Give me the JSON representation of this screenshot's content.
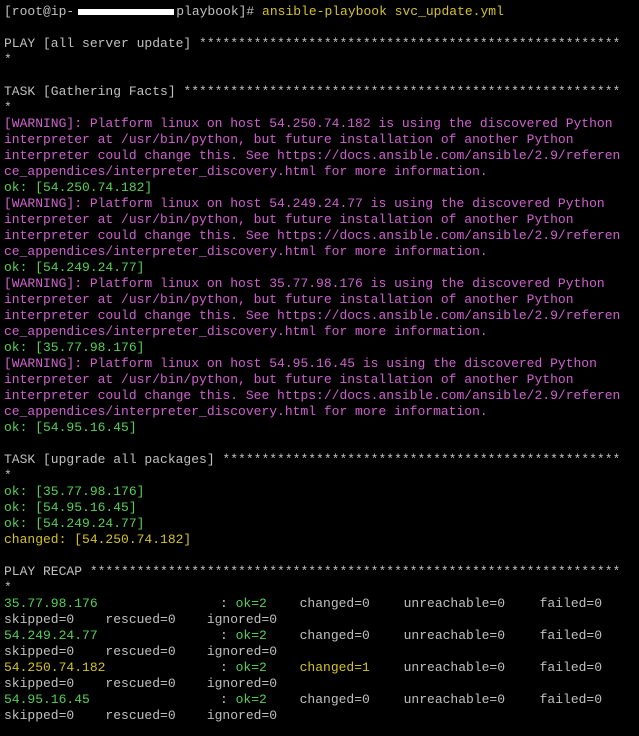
{
  "terminal": {
    "prompt": {
      "user_prefix": "[root@ip-",
      "suffix": "playbook]# ",
      "command": "ansible-playbook svc_update.yml"
    },
    "lines": [
      {
        "t": "blank"
      },
      {
        "t": "text",
        "c": "w",
        "text": "PLAY [all server update] ******************************************************"
      },
      {
        "t": "text",
        "c": "w",
        "text": "*"
      },
      {
        "t": "blank"
      },
      {
        "t": "text",
        "c": "w",
        "text": "TASK [Gathering Facts] ********************************************************"
      },
      {
        "t": "text",
        "c": "w",
        "text": "*"
      },
      {
        "t": "text",
        "c": "m",
        "text": "[WARNING]: Platform linux on host 54.250.74.182 is using the discovered Python"
      },
      {
        "t": "text",
        "c": "m",
        "text": "interpreter at /usr/bin/python, but future installation of another Python"
      },
      {
        "t": "text",
        "c": "m",
        "text": "interpreter could change this. See https://docs.ansible.com/ansible/2.9/referen"
      },
      {
        "t": "text",
        "c": "m",
        "text": "ce_appendices/interpreter_discovery.html for more information."
      },
      {
        "t": "text",
        "c": "g",
        "text": "ok: [54.250.74.182]"
      },
      {
        "t": "text",
        "c": "m",
        "text": "[WARNING]: Platform linux on host 54.249.24.77 is using the discovered Python"
      },
      {
        "t": "text",
        "c": "m",
        "text": "interpreter at /usr/bin/python, but future installation of another Python"
      },
      {
        "t": "text",
        "c": "m",
        "text": "interpreter could change this. See https://docs.ansible.com/ansible/2.9/referen"
      },
      {
        "t": "text",
        "c": "m",
        "text": "ce_appendices/interpreter_discovery.html for more information."
      },
      {
        "t": "text",
        "c": "g",
        "text": "ok: [54.249.24.77]"
      },
      {
        "t": "text",
        "c": "m",
        "text": "[WARNING]: Platform linux on host 35.77.98.176 is using the discovered Python"
      },
      {
        "t": "text",
        "c": "m",
        "text": "interpreter at /usr/bin/python, but future installation of another Python"
      },
      {
        "t": "text",
        "c": "m",
        "text": "interpreter could change this. See https://docs.ansible.com/ansible/2.9/referen"
      },
      {
        "t": "text",
        "c": "m",
        "text": "ce_appendices/interpreter_discovery.html for more information."
      },
      {
        "t": "text",
        "c": "g",
        "text": "ok: [35.77.98.176]"
      },
      {
        "t": "text",
        "c": "m",
        "text": "[WARNING]: Platform linux on host 54.95.16.45 is using the discovered Python"
      },
      {
        "t": "text",
        "c": "m",
        "text": "interpreter at /usr/bin/python, but future installation of another Python"
      },
      {
        "t": "text",
        "c": "m",
        "text": "interpreter could change this. See https://docs.ansible.com/ansible/2.9/referen"
      },
      {
        "t": "text",
        "c": "m",
        "text": "ce_appendices/interpreter_discovery.html for more information."
      },
      {
        "t": "text",
        "c": "g",
        "text": "ok: [54.95.16.45]"
      },
      {
        "t": "blank"
      },
      {
        "t": "text",
        "c": "w",
        "text": "TASK [upgrade all packages] ***************************************************"
      },
      {
        "t": "text",
        "c": "w",
        "text": "*"
      },
      {
        "t": "text",
        "c": "g",
        "text": "ok: [35.77.98.176]"
      },
      {
        "t": "text",
        "c": "g",
        "text": "ok: [54.95.16.45]"
      },
      {
        "t": "text",
        "c": "g",
        "text": "ok: [54.249.24.77]"
      },
      {
        "t": "text",
        "c": "y",
        "text": "changed: [54.250.74.182]"
      },
      {
        "t": "blank"
      },
      {
        "t": "text",
        "c": "w",
        "text": "PLAY RECAP ********************************************************************"
      },
      {
        "t": "text",
        "c": "w",
        "text": "*"
      },
      {
        "t": "recap",
        "host": "35.77.98.176",
        "host_c": "g",
        "ok": "ok=2",
        "changed": "changed=0",
        "changed_c": "w",
        "unreachable": "unreachable=0",
        "failed": "failed=0"
      },
      {
        "t": "text",
        "c": "w",
        "text": "skipped=0    rescued=0    ignored=0"
      },
      {
        "t": "recap",
        "host": "54.249.24.77",
        "host_c": "g",
        "ok": "ok=2",
        "changed": "changed=0",
        "changed_c": "w",
        "unreachable": "unreachable=0",
        "failed": "failed=0"
      },
      {
        "t": "text",
        "c": "w",
        "text": "skipped=0    rescued=0    ignored=0"
      },
      {
        "t": "recap",
        "host": "54.250.74.182",
        "host_c": "y",
        "ok": "ok=2",
        "changed": "changed=1",
        "changed_c": "y",
        "unreachable": "unreachable=0",
        "failed": "failed=0"
      },
      {
        "t": "text",
        "c": "w",
        "text": "skipped=0    rescued=0    ignored=0"
      },
      {
        "t": "recap",
        "host": "54.95.16.45",
        "host_c": "g",
        "ok": "ok=2",
        "changed": "changed=0",
        "changed_c": "w",
        "unreachable": "unreachable=0",
        "failed": "failed=0"
      },
      {
        "t": "text",
        "c": "w",
        "text": "skipped=0    rescued=0    ignored=0"
      }
    ]
  },
  "colors": {
    "background": "#000000",
    "default_text": "#c0c0c0",
    "ok_green": "#55d055",
    "changed_yellow": "#d4c227",
    "warning_magenta": "#d060d0"
  }
}
